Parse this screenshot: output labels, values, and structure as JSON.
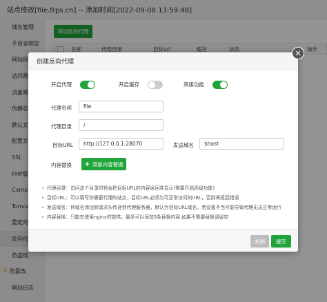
{
  "window": {
    "title": "站点修改[file.frps.cn] -- 添加时间[2022-09-08 13:59:48]"
  },
  "sidebar": {
    "items": [
      {
        "label": "域名管理"
      },
      {
        "label": "子目录绑定"
      },
      {
        "label": "网站目"
      },
      {
        "label": "访问限"
      },
      {
        "label": "流量限"
      },
      {
        "label": "伪静态"
      },
      {
        "label": "默认文"
      },
      {
        "label": "配置文"
      },
      {
        "label": "SSL"
      },
      {
        "label": "PHP版"
      },
      {
        "label": "Compo"
      },
      {
        "label": "Tomca"
      },
      {
        "label": "重定向"
      },
      {
        "label": "反向代"
      },
      {
        "label": "防盗链"
      },
      {
        "label": "防篡改"
      },
      {
        "label": "网站日志"
      }
    ]
  },
  "main": {
    "add_button": "添加反向代理",
    "table_headers": [
      "名称",
      "代理目录",
      "目标url",
      "缓存",
      "状态",
      "操作"
    ]
  },
  "dialog": {
    "title": "创建反向代理",
    "toggles": [
      {
        "label": "开启代理",
        "state": "on"
      },
      {
        "label": "开启缓存",
        "state": "off"
      },
      {
        "label": "高级功能",
        "state": "on"
      }
    ],
    "fields": {
      "proxy_name_label": "代理名称",
      "proxy_name_value": "file",
      "proxy_dir_label": "代理目录",
      "proxy_dir_value": "/",
      "target_url_label": "目标URL",
      "target_url_value": "http://127.0.0.1:28070",
      "send_domain_label": "发送域名",
      "send_domain_value": "$host",
      "content_replace_label": "内容替换",
      "add_replace_button": "添加内容替换"
    },
    "tips": [
      "代理目录：访问这个目录时将会把目标URL的内容返回并显示(需要开启高级功能)",
      "目标URL：可以填写你需要代理的站点，目标URL必须为可正常访问的URL，否则将返回错误",
      "发送域名：将域名添加到请求头传递到代理服务器，默认为目标URL域名，若设置不当可能导致代理无法正常运行",
      "内容替换：只能在使用nginx时提供，最多可以添加3条替换内容,如果不需要替换请留空"
    ],
    "close_button": "关闭",
    "submit_button": "提交"
  },
  "colors": {
    "accent": "#20a53a",
    "toggle_off": "#cccccc",
    "overlay": "rgba(0,0,0,0.42)"
  },
  "icons": {
    "close": "close-icon",
    "plus": "plus-icon",
    "shield": "shield-icon"
  }
}
